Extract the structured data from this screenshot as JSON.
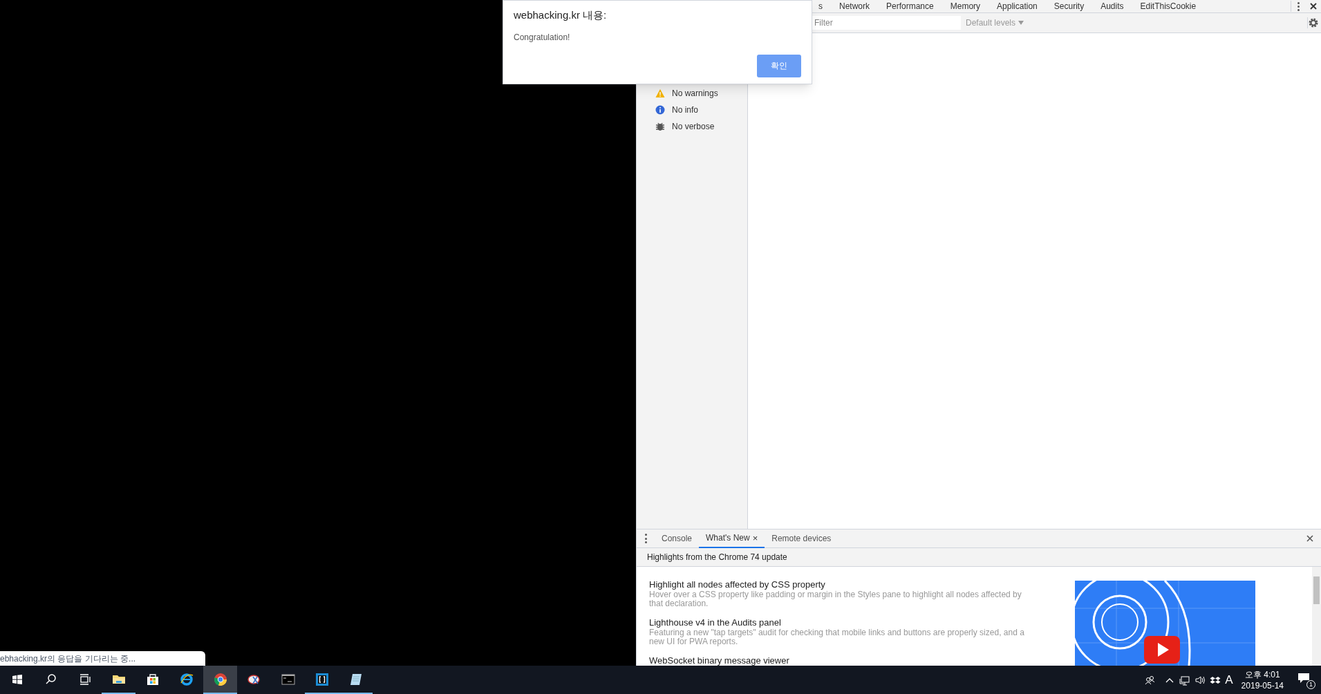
{
  "status_tooltip": "ebhacking.kr의 응답을 기다리는 중...",
  "dialog": {
    "title": "webhacking.kr 내용:",
    "message": "Congratulation!",
    "button": "확인"
  },
  "devtools": {
    "tabs": [
      {
        "label": "s",
        "selected": false
      },
      {
        "label": "Network",
        "selected": false
      },
      {
        "label": "Performance",
        "selected": false
      },
      {
        "label": "Memory",
        "selected": false
      },
      {
        "label": "Application",
        "selected": false
      },
      {
        "label": "Security",
        "selected": false
      },
      {
        "label": "Audits",
        "selected": false
      },
      {
        "label": "EditThisCookie",
        "selected": false
      }
    ],
    "filter": {
      "placeholder": "Filter"
    },
    "levels": "Default levels",
    "sidebar": [
      {
        "kind": "warning",
        "label": "No warnings"
      },
      {
        "kind": "info",
        "label": "No info"
      },
      {
        "kind": "verbose",
        "label": "No verbose"
      }
    ],
    "drawer_tabs": [
      {
        "label": "Console",
        "selected": false,
        "closable": false
      },
      {
        "label": "What's New",
        "selected": true,
        "closable": true
      },
      {
        "label": "Remote devices",
        "selected": false,
        "closable": false
      }
    ],
    "close_tab": "×",
    "drawer_header": "Highlights from the Chrome 74 update",
    "items": [
      {
        "title": "Highlight all nodes affected by CSS property",
        "body": "Hover over a CSS property like padding or margin in the Styles pane to highlight all nodes affected by that declaration."
      },
      {
        "title": "Lighthouse v4 in the Audits panel",
        "body": "Featuring a new \"tap targets\" audit for checking that mobile links and buttons are properly sized, and a new UI for PWA reports."
      },
      {
        "title": "WebSocket binary message viewer"
      }
    ]
  },
  "taskbar": {
    "apps": [
      {
        "kind": "start",
        "running": false,
        "selected": false
      },
      {
        "kind": "search",
        "running": false,
        "selected": false
      },
      {
        "kind": "taskview",
        "running": false,
        "selected": false
      },
      {
        "kind": "explorer",
        "running": true,
        "selected": false
      },
      {
        "kind": "store",
        "running": false,
        "selected": false
      },
      {
        "kind": "ie",
        "running": false,
        "selected": false
      },
      {
        "kind": "chrome",
        "running": true,
        "selected": true
      },
      {
        "kind": "snip",
        "running": false,
        "selected": false
      },
      {
        "kind": "cmd",
        "running": false,
        "selected": false
      },
      {
        "kind": "brackets",
        "running": true,
        "selected": false
      },
      {
        "kind": "notepad",
        "running": true,
        "selected": false
      }
    ],
    "ime": "A",
    "time": "오후 4:01",
    "date": "2019-05-14",
    "notifications": "1"
  }
}
